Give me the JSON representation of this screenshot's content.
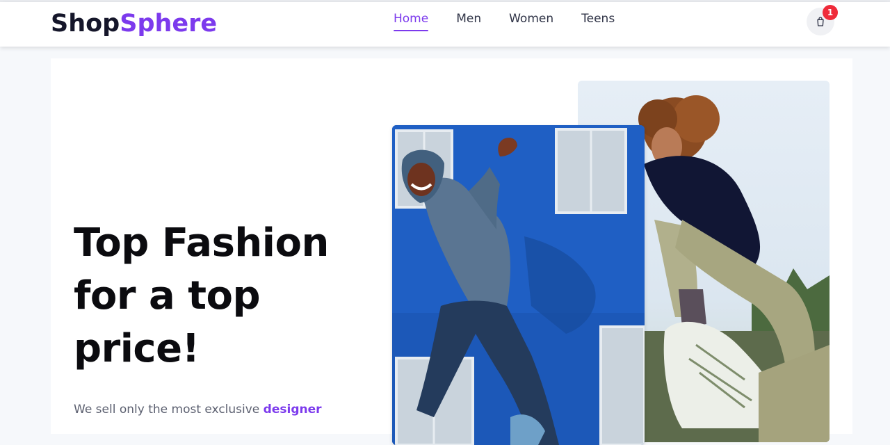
{
  "brand": {
    "part1": "Shop",
    "part2": "Sphere"
  },
  "nav": {
    "items": [
      {
        "label": "Home",
        "active": true
      },
      {
        "label": "Men",
        "active": false
      },
      {
        "label": "Women",
        "active": false
      },
      {
        "label": "Teens",
        "active": false
      }
    ]
  },
  "cart": {
    "icon": "shopping-bag-icon",
    "count": "1"
  },
  "hero": {
    "headline": "Top Fashion for a top price!",
    "subtitle_prefix": "We sell only the most exclusive",
    "subtitle_highlight": "designer"
  },
  "colors": {
    "accent": "#7c3aed",
    "badge": "#ef2b3a",
    "logo_dark": "#15162a"
  }
}
